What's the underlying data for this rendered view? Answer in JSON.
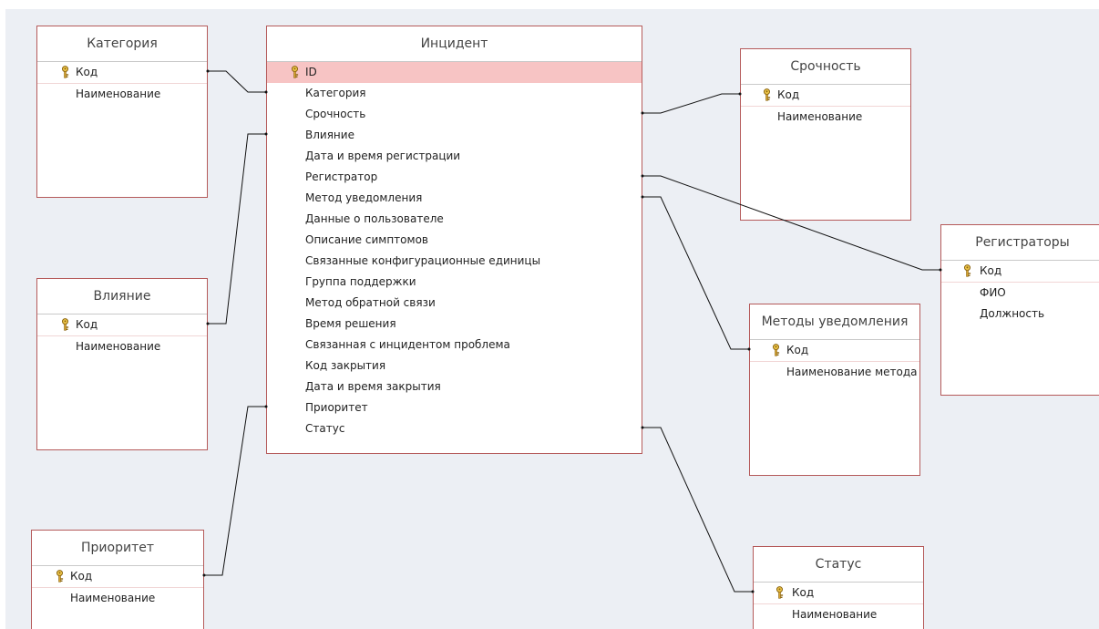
{
  "diagram": {
    "background_color": "#eceff4",
    "border_color": "#b55a5a",
    "key_icon": "key-icon",
    "tables": [
      {
        "id": "kategoriya",
        "title": "Категория",
        "pk_selected": false,
        "fields": [
          {
            "name": "Код",
            "pk": true
          },
          {
            "name": "Наименование",
            "pk": false
          }
        ]
      },
      {
        "id": "incident",
        "title": "Инцидент",
        "pk_selected": true,
        "fields": [
          {
            "name": "ID",
            "pk": true
          },
          {
            "name": "Категория",
            "pk": false
          },
          {
            "name": "Срочность",
            "pk": false
          },
          {
            "name": "Влияние",
            "pk": false
          },
          {
            "name": "Дата и время регистрации",
            "pk": false
          },
          {
            "name": "Регистратор",
            "pk": false
          },
          {
            "name": "Метод уведомления",
            "pk": false
          },
          {
            "name": "Данные о пользователе",
            "pk": false
          },
          {
            "name": "Описание симптомов",
            "pk": false
          },
          {
            "name": "Связанные конфигурационные единицы",
            "pk": false
          },
          {
            "name": "Группа поддержки",
            "pk": false
          },
          {
            "name": "Метод обратной связи",
            "pk": false
          },
          {
            "name": "Время решения",
            "pk": false
          },
          {
            "name": "Связанная с инцидентом проблема",
            "pk": false
          },
          {
            "name": "Код закрытия",
            "pk": false
          },
          {
            "name": "Дата и время закрытия",
            "pk": false
          },
          {
            "name": "Приоритет",
            "pk": false
          },
          {
            "name": "Статус",
            "pk": false
          }
        ]
      },
      {
        "id": "srochnost",
        "title": "Срочность",
        "pk_selected": false,
        "fields": [
          {
            "name": "Код",
            "pk": true
          },
          {
            "name": "Наименование",
            "pk": false
          }
        ]
      },
      {
        "id": "registratory",
        "title": "Регистраторы",
        "pk_selected": false,
        "fields": [
          {
            "name": "Код",
            "pk": true
          },
          {
            "name": "ФИО",
            "pk": false
          },
          {
            "name": "Должность",
            "pk": false
          }
        ]
      },
      {
        "id": "vliyanie",
        "title": "Влияние",
        "pk_selected": false,
        "fields": [
          {
            "name": "Код",
            "pk": true
          },
          {
            "name": "Наименование",
            "pk": false
          }
        ]
      },
      {
        "id": "metody",
        "title": "Методы уведомления",
        "pk_selected": false,
        "fields": [
          {
            "name": "Код",
            "pk": true
          },
          {
            "name": "Наименование метода",
            "pk": false
          }
        ]
      },
      {
        "id": "prioritet",
        "title": "Приоритет",
        "pk_selected": false,
        "fields": [
          {
            "name": "Код",
            "pk": true
          },
          {
            "name": "Наименование",
            "pk": false
          }
        ]
      },
      {
        "id": "status",
        "title": "Статус",
        "pk_selected": false,
        "fields": [
          {
            "name": "Код",
            "pk": true
          },
          {
            "name": "Наименование",
            "pk": false
          }
        ]
      }
    ],
    "relationships": [
      {
        "from": "kategoriya.Код",
        "to": "incident.Категория"
      },
      {
        "from": "incident.Срочность",
        "to": "srochnost.Код"
      },
      {
        "from": "vliyanie.Код",
        "to": "incident.Влияние"
      },
      {
        "from": "incident.Регистратор",
        "to": "registratory.Код"
      },
      {
        "from": "incident.Метод уведомления",
        "to": "metody.Код"
      },
      {
        "from": "prioritet.Код",
        "to": "incident.Приоритет"
      },
      {
        "from": "incident.Статус",
        "to": "status.Код"
      }
    ]
  }
}
